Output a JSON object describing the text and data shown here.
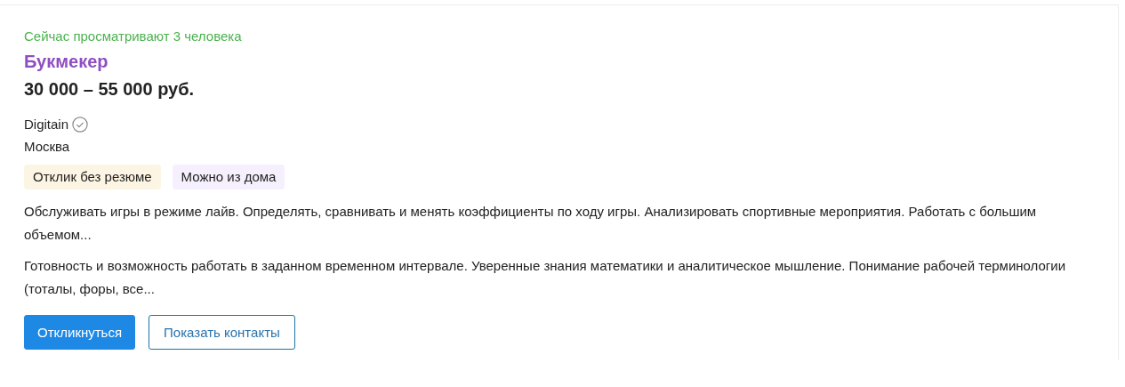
{
  "vacancy": {
    "viewers": "Сейчас просматривают 3 человека",
    "title": "Букмекер",
    "salary": "30 000 – 55 000 руб.",
    "company": {
      "name": "Digitain",
      "verified": true
    },
    "city": "Москва",
    "tags": [
      {
        "label": "Отклик без резюме",
        "color": "#fdf5e3"
      },
      {
        "label": "Можно из дома",
        "color": "#f6effd"
      }
    ],
    "snippets": [
      "Обслуживать игры в режиме лайв. Определять, сравнивать и менять коэффициенты по ходу игры. Анализировать спортивные мероприятия. Работать с большим объемом...",
      "Готовность и возможность работать в заданном временном интервале. Уверенные знания математики и аналитическое мышление. Понимание рабочей терминологии (тоталы, форы, все..."
    ],
    "buttons": [
      {
        "label": "Откликнуться",
        "kind": "primary"
      },
      {
        "label": "Показать контакты",
        "kind": "outline"
      }
    ]
  }
}
